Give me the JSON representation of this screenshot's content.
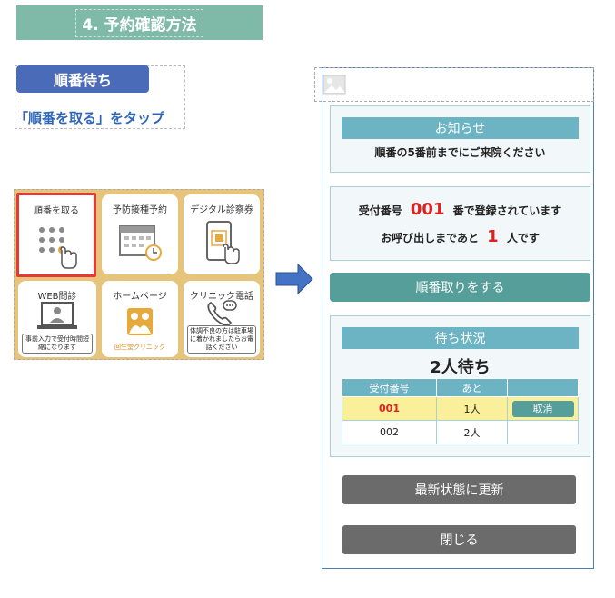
{
  "section_title": "4. 予約確認方法",
  "badge": "順番待ち",
  "instruction": "「順番を取る」をタップ",
  "menu": {
    "tiles": [
      {
        "label": "順番を取る",
        "icon": "keypad-tap-icon",
        "highlighted": true
      },
      {
        "label": "予防接種予約",
        "icon": "calendar-clock-icon"
      },
      {
        "label": "デジタル診察券",
        "icon": "phone-card-icon"
      },
      {
        "label": "WEB問診",
        "icon": "laptop-doctor-icon",
        "note": "事前入力で受付時間短縮になります"
      },
      {
        "label": "ホームページ",
        "icon": "clinic-logo-icon",
        "brand": "回生堂クリニック"
      },
      {
        "label": "クリニック電話",
        "icon": "phone-call-icon",
        "note": "体調不良の方は駐車場に着かれましたらお電話ください"
      }
    ]
  },
  "phone": {
    "notice": {
      "title": "お知らせ",
      "text": "順番の5番前までにご来院ください"
    },
    "registration": {
      "prefix": "受付番号",
      "number": "001",
      "suffix": "番で登録されています",
      "wait_prefix": "お呼び出しまであと",
      "wait_count": "1",
      "wait_suffix": "人です"
    },
    "take_number_button": "順番取りをする",
    "status": {
      "title": "待ち状況",
      "count_text": "2人待ち",
      "columns": [
        "受付番号",
        "あと",
        ""
      ],
      "rows": [
        {
          "number": "001",
          "remaining": "1人",
          "action": "取消",
          "mine": true
        },
        {
          "number": "002",
          "remaining": "2人",
          "action": "",
          "mine": false
        }
      ]
    },
    "refresh_button": "最新状態に更新",
    "close_button": "閉じる"
  },
  "colors": {
    "title_bar": "#7fbaa9",
    "badge": "#4a6bb7",
    "instruction_text": "#2f67b8",
    "teal_header": "#6cb3c3",
    "teal_button": "#559e99",
    "highlight_red": "#e02020",
    "gray_button": "#6b6b6b",
    "my_row": "#fbf09a",
    "tile_background": "#e7c47b"
  }
}
